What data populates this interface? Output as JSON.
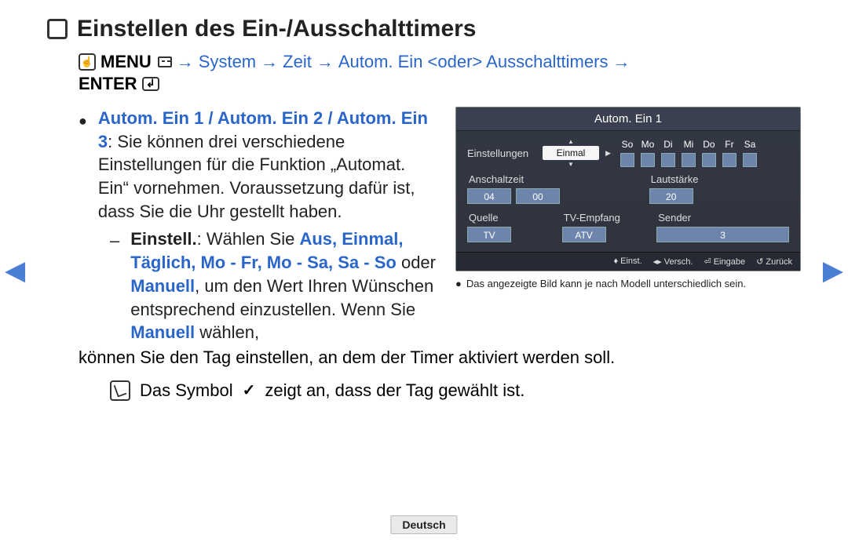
{
  "title": "Einstellen des Ein-/Ausschalttimers",
  "path": {
    "menu": "MENU",
    "step1": "System",
    "step2": "Zeit",
    "step3": "Autom. Ein <oder> Ausschalttimers",
    "enter": "ENTER",
    "arrow": "→"
  },
  "body": {
    "lead_blue": "Autom. Ein 1 / Autom. Ein 2 / Autom. Ein 3",
    "lead_rest": ": Sie können drei verschiedene Einstellungen für die Funktion „Automat. Ein“ vornehmen. Voraussetzung dafür ist, dass Sie die Uhr gestellt haben.",
    "sub_label": "Einstell.",
    "sub_pre": ": Wählen Sie ",
    "sub_blue1": "Aus, Einmal, Täglich, Mo - Fr, Mo - Sa, Sa - So",
    "sub_mid": " oder ",
    "sub_blue2": "Manuell",
    "sub_post": ", um den Wert Ihren Wünschen entsprechend einzustellen. Wenn Sie ",
    "sub_blue3": "Manuell",
    "sub_tail": " wählen,",
    "continue": "können Sie den Tag einstellen, an dem der Timer aktiviert werden soll.",
    "note": "Das Symbol",
    "note2": "zeigt an, dass der Tag gewählt ist."
  },
  "panel": {
    "title": "Autom. Ein 1",
    "settings_label": "Einstellungen",
    "once": "Einmal",
    "days": [
      "So",
      "Mo",
      "Di",
      "Mi",
      "Do",
      "Fr",
      "Sa"
    ],
    "anschaltzeit": "Anschaltzeit",
    "lautstarke": "Lautstärke",
    "hour": "04",
    "minute": "00",
    "volume": "20",
    "quelle": "Quelle",
    "tvempfang": "TV-Empfang",
    "sender": "Sender",
    "quelle_val": "TV",
    "tvempfang_val": "ATV",
    "sender_val": "3",
    "footer": {
      "einst": "Einst.",
      "versch": "Versch.",
      "eingabe": "Eingabe",
      "zuruck": "Zurück"
    },
    "caption": "Das angezeigte Bild kann je nach Modell unterschiedlich sein."
  },
  "language": "Deutsch"
}
